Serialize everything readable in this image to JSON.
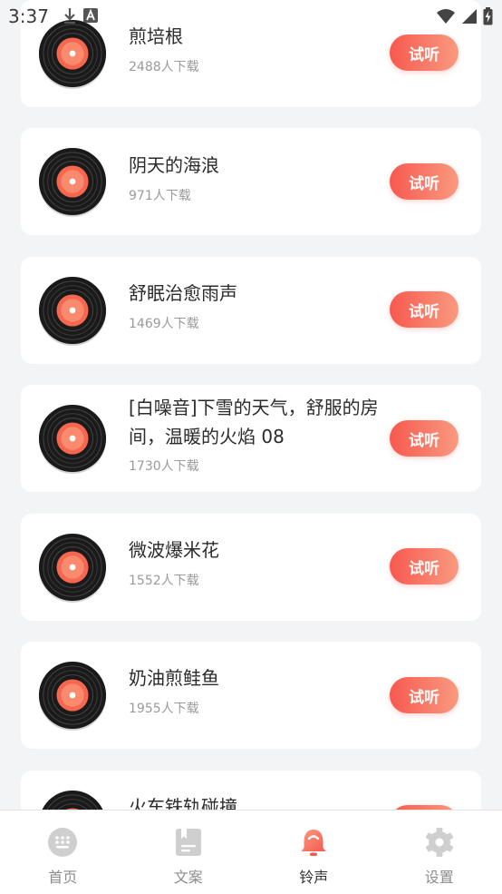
{
  "status_bar": {
    "time": "3:37"
  },
  "list": {
    "button_label": "试听",
    "items": [
      {
        "title": "煎培根",
        "downloads": "2488人下载"
      },
      {
        "title": "阴天的海浪",
        "downloads": "971人下载"
      },
      {
        "title": "舒眠治愈雨声",
        "downloads": "1469人下载"
      },
      {
        "title": "[白噪音]下雪的天气，舒服的房间，温暖的火焰 08",
        "downloads": "1730人下载"
      },
      {
        "title": "微波爆米花",
        "downloads": "1552人下载"
      },
      {
        "title": "奶油煎鲑鱼",
        "downloads": "1955人下载"
      },
      {
        "title": "火车铁轨碰撞",
        "downloads": ""
      }
    ]
  },
  "tabbar": {
    "tabs": [
      {
        "label": "首页",
        "icon": "grid-icon"
      },
      {
        "label": "文案",
        "icon": "note-icon"
      },
      {
        "label": "铃声",
        "icon": "bell-icon",
        "active": true
      },
      {
        "label": "设置",
        "icon": "gear-icon"
      }
    ]
  },
  "colors": {
    "accent": "#f7594f",
    "accent_light": "#f99a7f",
    "background": "#f3f4f6"
  }
}
